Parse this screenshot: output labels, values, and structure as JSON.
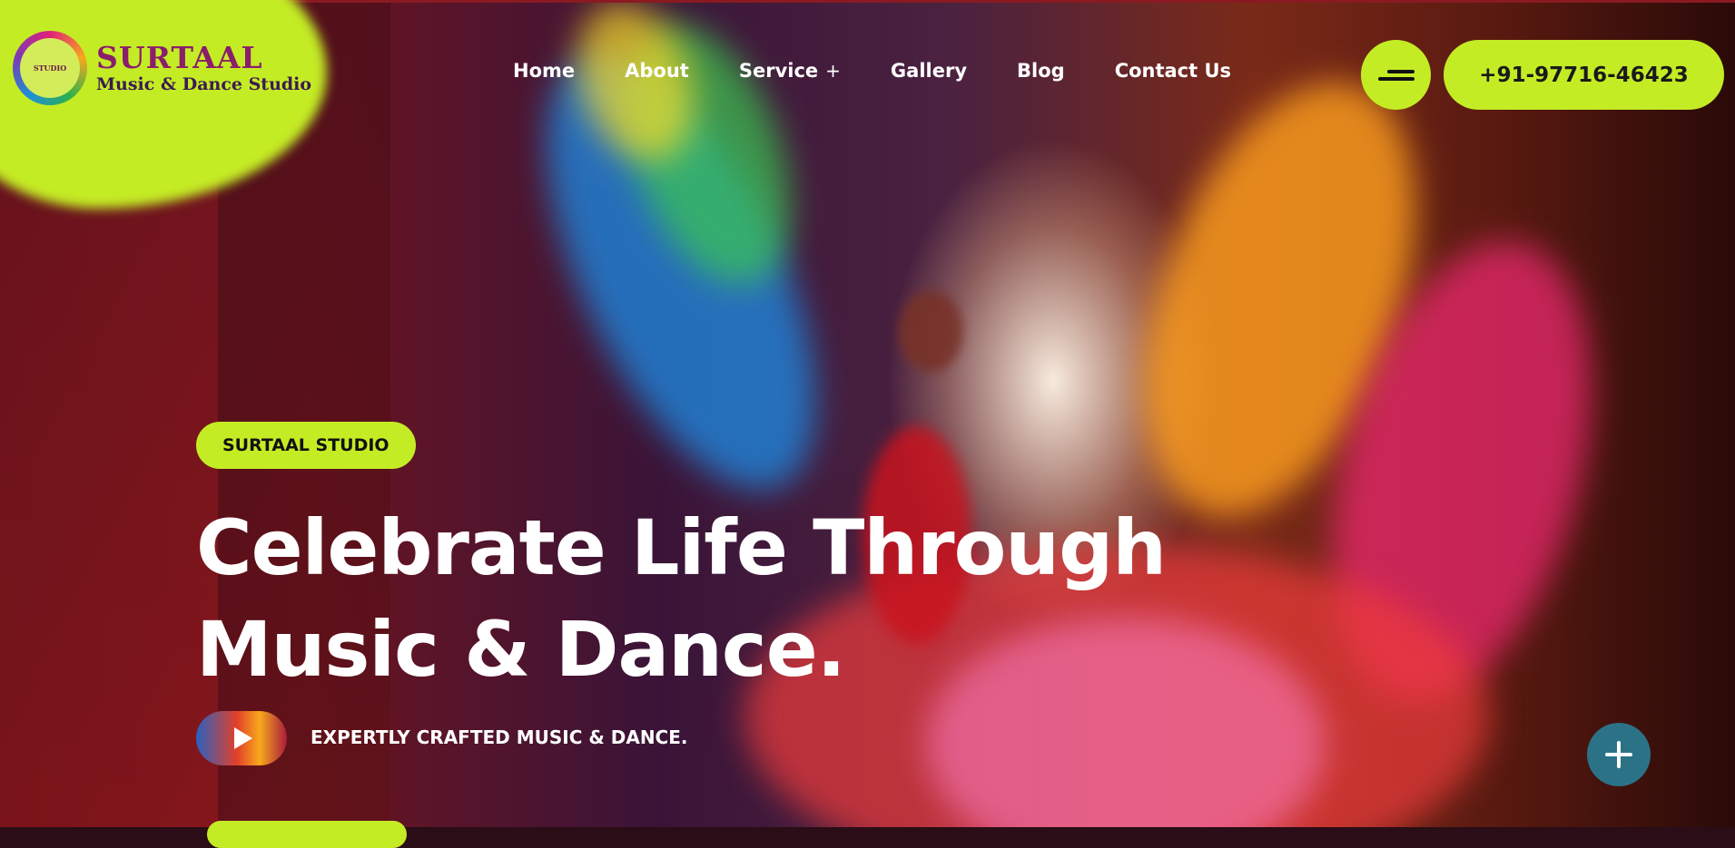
{
  "brand": {
    "name": "SURTAAL",
    "tagline": "Music & Dance Studio",
    "mark_text": "STUDIO",
    "colors": {
      "accent": "#c4ec25",
      "fab": "#2b7287",
      "logo_title": "#8a1e6a"
    }
  },
  "nav": {
    "items": [
      {
        "label": "Home"
      },
      {
        "label": "About"
      },
      {
        "label": "Service",
        "has_submenu": true,
        "submenu_indicator": "+"
      },
      {
        "label": "Gallery"
      },
      {
        "label": "Blog"
      },
      {
        "label": "Contact Us"
      }
    ]
  },
  "header": {
    "menu_icon": "hamburger-menu-icon",
    "phone_label": "+91-97716-46423"
  },
  "hero": {
    "tag": "SURTAAL STUDIO",
    "headline_line1": "Celebrate Life Through",
    "headline_line2": "Music & Dance.",
    "subtitle": "EXPERTLY CRAFTED MUSIC & DANCE.",
    "video_icon": "play-icon"
  },
  "fab": {
    "icon": "plus-icon"
  }
}
